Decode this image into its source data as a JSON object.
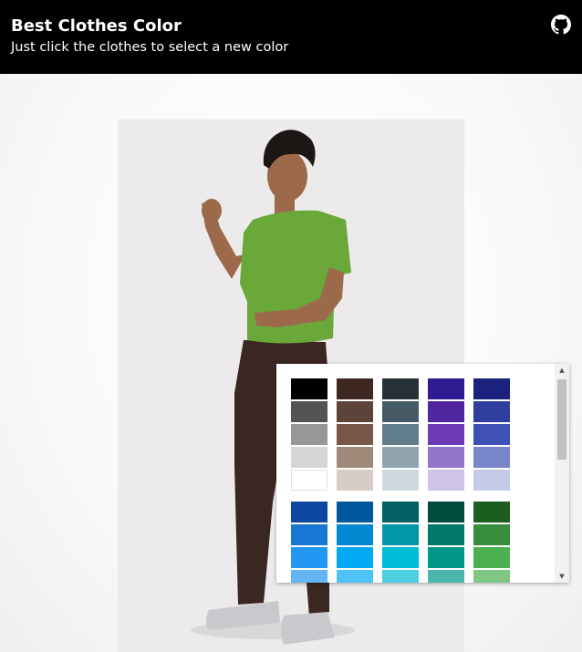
{
  "header": {
    "title": "Best Clothes Color",
    "subtitle": "Just click the clothes to select a new color",
    "github_icon": "github-icon"
  },
  "model": {
    "shirt_color": "#6ba83a",
    "pants_color": "#3b2722",
    "shoe_color": "#c7c9cc",
    "skin_color": "#9c6a4b",
    "hair_color": "#1c1715"
  },
  "color_picker": {
    "scrollbar": {
      "up_icon": "arrow-up-icon",
      "down_icon": "arrow-down-icon"
    },
    "groups": [
      {
        "columns": [
          [
            "#000000",
            "#535353",
            "#979797",
            "#d6d6d6",
            "#ffffff"
          ],
          [
            "#3e2621",
            "#5e433a",
            "#7a5649",
            "#a18979",
            "#d8ccc7"
          ],
          [
            "#263238",
            "#455a64",
            "#617d8b",
            "#90a4ae",
            "#cfd8dc"
          ],
          [
            "#301b92",
            "#5127a0",
            "#6b3ab4",
            "#9575cc",
            "#d0c3e8"
          ],
          [
            "#1a227e",
            "#2f3e9e",
            "#3f51b5",
            "#7885ca",
            "#c5cae9"
          ]
        ]
      },
      {
        "columns": [
          [
            "#0e47a1",
            "#1976d2",
            "#2196f3",
            "#64b5f6"
          ],
          [
            "#01579b",
            "#0288d1",
            "#03a9f4",
            "#4fc3f7"
          ],
          [
            "#006064",
            "#0097a7",
            "#00bcd4",
            "#4dd0e1"
          ],
          [
            "#004d40",
            "#00796b",
            "#009688",
            "#4db6ac"
          ],
          [
            "#1b5e20",
            "#388e3c",
            "#4caf50",
            "#81c784"
          ]
        ]
      }
    ]
  }
}
